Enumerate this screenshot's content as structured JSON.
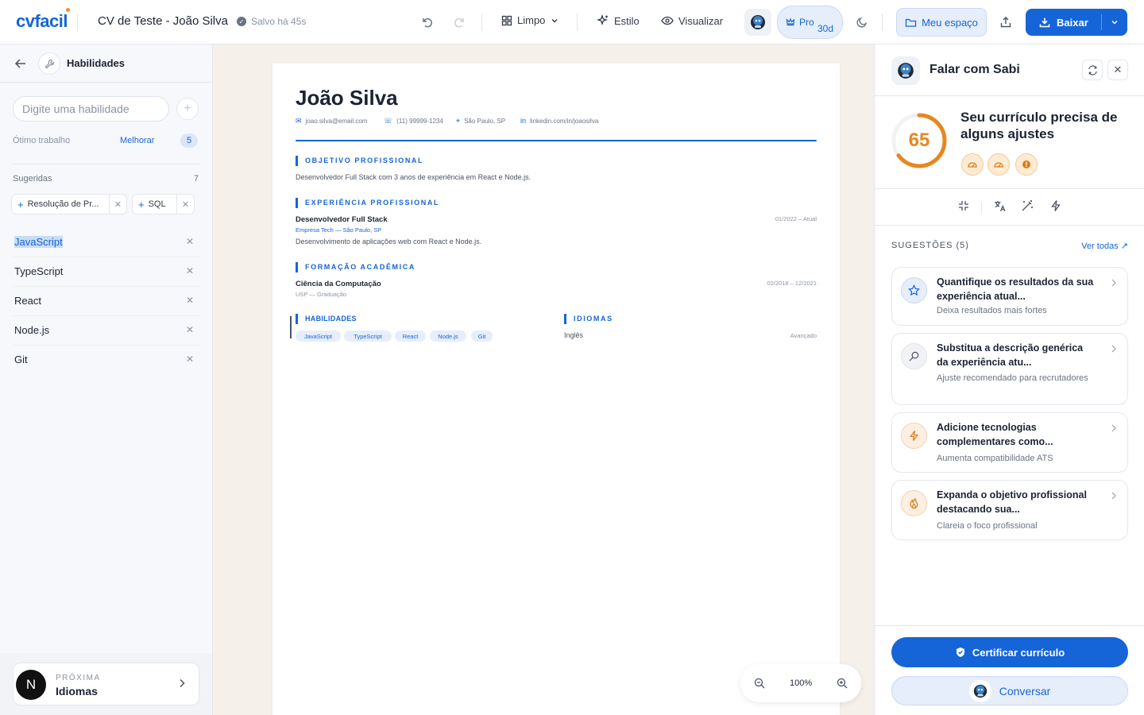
{
  "topbar": {
    "logo": "cvfacil",
    "doc_title": "CV de Teste - João Silva",
    "saved_status": "Salvo há 45s",
    "template_label": "Limpo",
    "style_label": "Estilo",
    "preview_label": "Visualizar",
    "pro_label": "Pro",
    "pro_days": "30d",
    "workspace_label": "Meu espaço",
    "download_label": "Baixar",
    "accent_color": "#1565d8"
  },
  "left": {
    "title": "Habilidades",
    "input_placeholder": "Digite uma habilidade",
    "level_label": "Ótimo trabalho",
    "improve_label": "Melhorar",
    "skill_count": "5",
    "suggested_label": "Sugeridas",
    "suggested_count": "7",
    "suggested_chips": [
      {
        "label": "Resolução de Pr..."
      },
      {
        "label": "SQL"
      }
    ],
    "skills": [
      {
        "name": "JavaScript",
        "selected": true
      },
      {
        "name": "TypeScript"
      },
      {
        "name": "React"
      },
      {
        "name": "Node.js"
      },
      {
        "name": "Git"
      }
    ],
    "next": {
      "kicker": "PRÓXIMA",
      "label": "Idiomas",
      "avatar_letter": "N"
    }
  },
  "cv": {
    "name": "João Silva",
    "email": "joao.silva@email.com",
    "phone": "(11) 99999-1234",
    "location": "São Paulo, SP",
    "linkedin": "linkedin.com/in/joaosilva",
    "objective_title": "OBJETIVO PROFISSIONAL",
    "objective_text": "Desenvolvedor Full Stack com 3 anos de experiência em React e Node.js.",
    "experience_title": "EXPERIÊNCIA PROFISSIONAL",
    "experience": {
      "role": "Desenvolvedor Full Stack",
      "company": "Empresa Tech — São Paulo, SP",
      "dates": "01/2022 – Atual",
      "description": "Desenvolvimento de aplicações web com React e Node.js."
    },
    "education_title": "FORMAÇÃO ACADÊMICA",
    "education": {
      "course": "Ciência da Computação",
      "school": "USP — Graduação",
      "dates": "02/2018 – 12/2021"
    },
    "skills_title": "HABILIDADES",
    "skill_tags": [
      "JavaScript",
      "TypeScript",
      "React",
      "Node.js",
      "Git"
    ],
    "languages_title": "IDIOMAS",
    "language": {
      "name": "Inglês",
      "level": "Avançado"
    }
  },
  "zoom": {
    "value": "100%"
  },
  "right": {
    "title": "Falar com Sabi",
    "score": "65",
    "score_fraction": 0.65,
    "score_color": "#e8871e",
    "score_message": "Seu currículo precisa de alguns ajustes",
    "suggestions_label": "SUGESTÕES (5)",
    "see_all_label": "Ver todas",
    "suggestions": [
      {
        "title": "Quantifique os resultados da sua experiência atual...",
        "subtitle": "Deixa resultados mais fortes",
        "icon": "star-icon"
      },
      {
        "title": "Substitua a descrição genérica da experiência atu...",
        "subtitle": "Ajuste recomendado para recrutadores",
        "icon": "search-icon"
      },
      {
        "title": "Adicione tecnologias complementares como...",
        "subtitle": "Aumenta compatibilidade ATS",
        "icon": "bolt-icon"
      },
      {
        "title": "Expanda o objetivo profissional destacando sua...",
        "subtitle": "Clareia o foco profissional",
        "icon": "flame-icon"
      }
    ],
    "certify_label": "Certificar currículo",
    "chat_label": "Conversar"
  }
}
